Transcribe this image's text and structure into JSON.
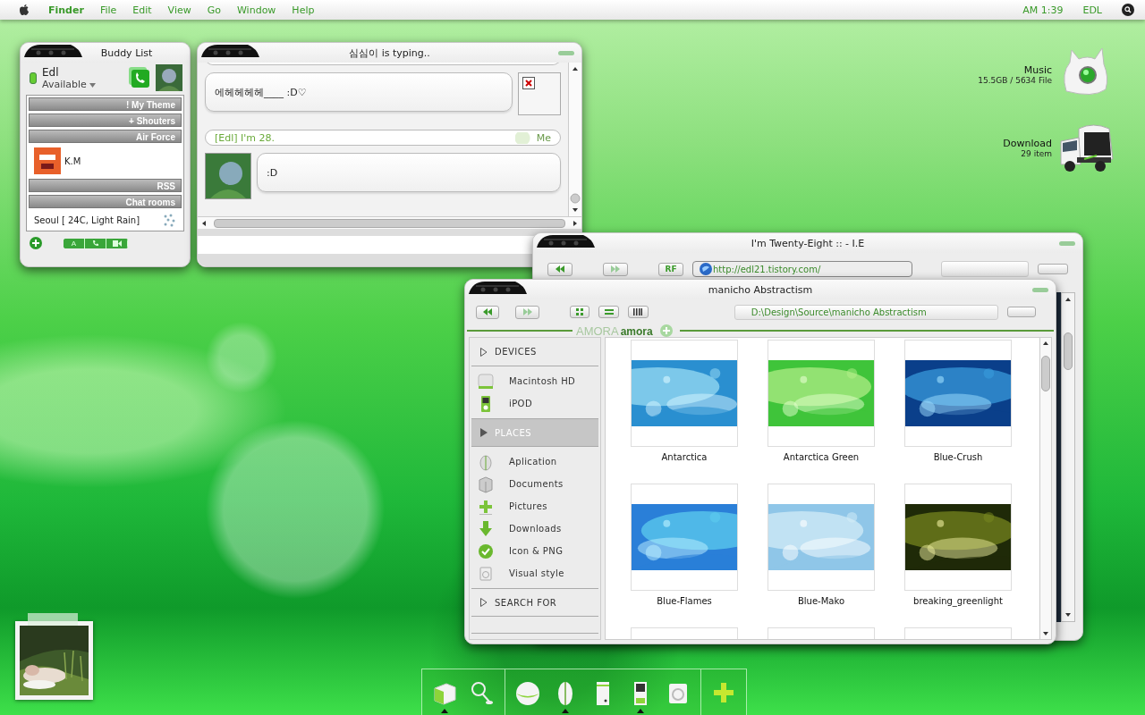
{
  "menu_bar": {
    "items": [
      {
        "kind": "app",
        "label": "Finder"
      },
      {
        "kind": "menu",
        "label": "File"
      },
      {
        "kind": "menu",
        "label": "Edit"
      },
      {
        "kind": "menu",
        "label": "View"
      },
      {
        "kind": "menu",
        "label": "Go"
      },
      {
        "kind": "menu",
        "label": "Window"
      },
      {
        "kind": "menu",
        "label": "Help"
      }
    ],
    "clock": "AM 1:39",
    "user": "EDL"
  },
  "desktop_icons": [
    {
      "kind": "music",
      "name": "Music",
      "info": "15.5GB / 5634 File"
    },
    {
      "kind": "truck",
      "name": "Download",
      "info": "29 item"
    }
  ],
  "buddy_list": {
    "title": "Buddy List",
    "name": "Edl",
    "status": "Available",
    "rows": [
      {
        "kind": "group",
        "label": "! My Theme"
      },
      {
        "kind": "group",
        "label": "+ Shouters"
      },
      {
        "kind": "group",
        "label": "Air Force"
      },
      {
        "kind": "buddy",
        "label": "K.M"
      },
      {
        "kind": "group",
        "label": "RSS"
      },
      {
        "kind": "group",
        "label": "Chat rooms"
      },
      {
        "kind": "weather",
        "label": "Seoul [ 24C, Light Rain]"
      }
    ],
    "buttons": [
      "A"
    ]
  },
  "chat": {
    "title": "심심이 is typing..",
    "messages": [
      {
        "kind": "bubble",
        "text": "에헤헤헤헤____ :D♡",
        "image": true,
        "avatar": false
      },
      {
        "kind": "header",
        "text": "[Edl] I'm 28.",
        "sender": "Me"
      },
      {
        "kind": "bubble",
        "text": ":D",
        "image": false,
        "avatar": true
      }
    ]
  },
  "browser": {
    "title": "I'm Twenty-Eight :: - I.E",
    "buttons": [
      "RF"
    ],
    "address": "http://edl21.tistory.com/"
  },
  "finder": {
    "title": "manicho Abstractism",
    "path": "D:\\Design\\Source\\manicho Abstractism",
    "tag_shadow": "AMORA",
    "tag": "amora",
    "sidebar": [
      {
        "kind": "heading",
        "label": "DEVICES",
        "selected": false
      },
      {
        "kind": "disk",
        "label": "Macintosh HD",
        "selected": false
      },
      {
        "kind": "ipod",
        "label": "iPOD",
        "selected": false
      },
      {
        "kind": "heading",
        "label": "PLACES",
        "selected": true
      },
      {
        "kind": "app",
        "label": "Aplication",
        "selected": false
      },
      {
        "kind": "docs",
        "label": "Documents",
        "selected": false
      },
      {
        "kind": "plus",
        "label": "Pictures",
        "selected": false
      },
      {
        "kind": "download",
        "label": "Downloads",
        "selected": false
      },
      {
        "kind": "check",
        "label": "Icon & PNG",
        "selected": false
      },
      {
        "kind": "style",
        "label": "Visual style",
        "selected": false
      },
      {
        "kind": "heading",
        "label": "SEARCH FOR",
        "selected": false
      }
    ],
    "files": [
      {
        "kind": "picture",
        "label": "Antarctica"
      },
      {
        "kind": "picture",
        "label": "Antarctica Green"
      },
      {
        "kind": "picture",
        "label": "Blue-Crush"
      },
      {
        "kind": "picture",
        "label": "Blue-Flames"
      },
      {
        "kind": "picture",
        "label": "Blue-Mako"
      },
      {
        "kind": "picture",
        "label": "breaking_greenlight"
      },
      {
        "kind": "blank"
      },
      {
        "kind": "blank"
      },
      {
        "kind": "blank"
      }
    ]
  },
  "dock": {
    "groups": [
      [
        {
          "kind": "box",
          "running": true
        },
        {
          "kind": "magnifier",
          "running": false
        }
      ],
      [
        {
          "kind": "sphere",
          "running": false
        },
        {
          "kind": "mouse",
          "running": true
        },
        {
          "kind": "drive",
          "running": false
        },
        {
          "kind": "ipod",
          "running": true
        },
        {
          "kind": "speaker",
          "running": false
        }
      ],
      [
        {
          "kind": "plus",
          "running": false
        }
      ]
    ]
  }
}
